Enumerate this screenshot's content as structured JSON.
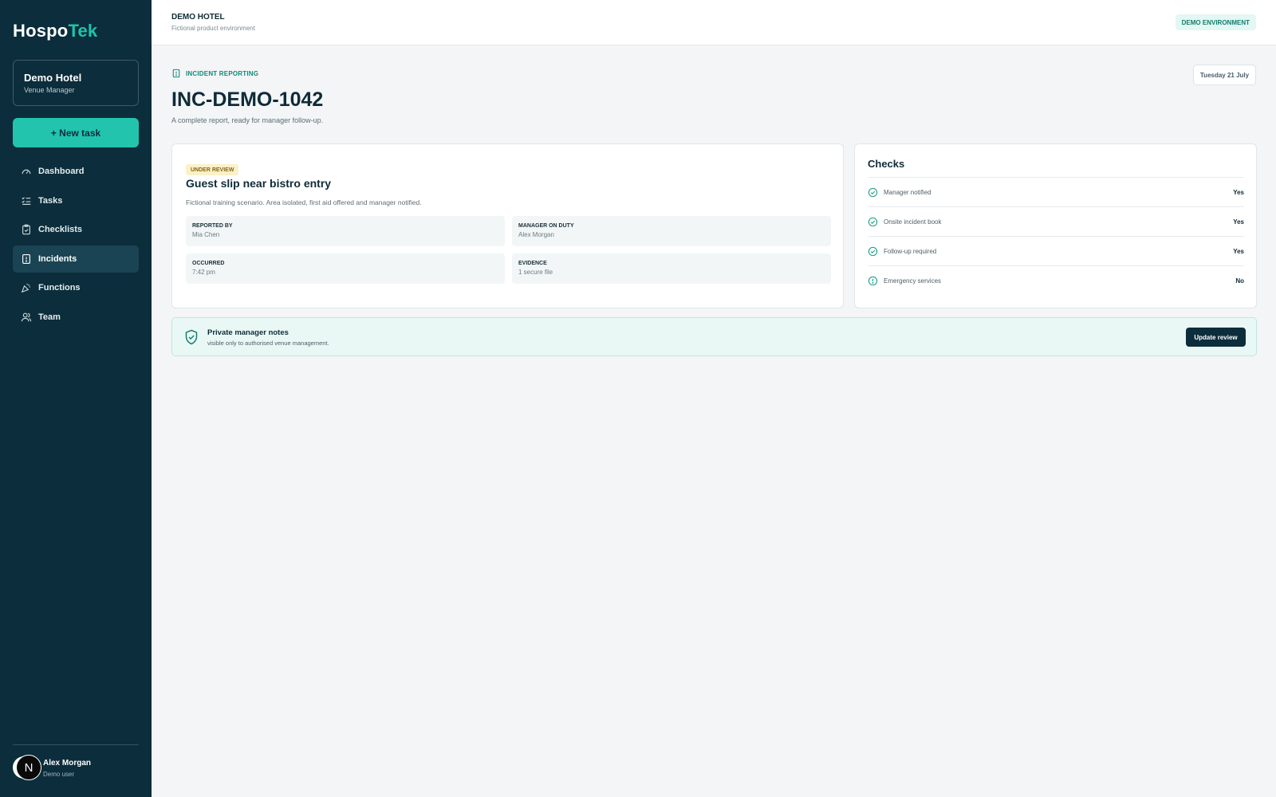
{
  "brand": {
    "part1": "Hospo",
    "part2": "Tek",
    "accent": "#20c3aa"
  },
  "venue": {
    "name": "Demo Hotel",
    "role": "Venue Manager"
  },
  "new_task_label": "+ New task",
  "nav": [
    {
      "label": "Dashboard",
      "icon": "gauge-icon",
      "active": false
    },
    {
      "label": "Tasks",
      "icon": "task-list-icon",
      "active": false
    },
    {
      "label": "Checklists",
      "icon": "clipboard-check-icon",
      "active": false
    },
    {
      "label": "Incidents",
      "icon": "incident-report-icon",
      "active": true
    },
    {
      "label": "Functions",
      "icon": "party-popper-icon",
      "active": false
    },
    {
      "label": "Team",
      "icon": "users-icon",
      "active": false
    }
  ],
  "user": {
    "avatar_letter": "N",
    "name": "Alex Morgan",
    "role": "Demo user"
  },
  "header": {
    "title": "DEMO HOTEL",
    "subtitle": "Fictional product environment",
    "env_badge": "DEMO ENVIRONMENT"
  },
  "page": {
    "section_label": "INCIDENT REPORTING",
    "date": "Tuesday 21 July",
    "title": "INC-DEMO-1042",
    "subtitle": "A complete report, ready for manager follow-up."
  },
  "incident": {
    "status": "UNDER REVIEW",
    "title": "Guest slip near bistro entry",
    "description": "Fictional training scenario. Area isolated, first aid offered and manager notified.",
    "fields": [
      {
        "label": "REPORTED BY",
        "value": "Mia Chen"
      },
      {
        "label": "MANAGER ON DUTY",
        "value": "Alex Morgan"
      },
      {
        "label": "OCCURRED",
        "value": "7:42 pm"
      },
      {
        "label": "EVIDENCE",
        "value": "1 secure file"
      }
    ]
  },
  "checks": {
    "title": "Checks",
    "items": [
      {
        "label": "Manager notified",
        "value": "Yes",
        "icon": "check-circle-icon"
      },
      {
        "label": "Onsite incident book",
        "value": "Yes",
        "icon": "check-circle-icon"
      },
      {
        "label": "Follow-up required",
        "value": "Yes",
        "icon": "check-circle-icon"
      },
      {
        "label": "Emergency services",
        "value": "No",
        "icon": "alert-circle-icon"
      }
    ]
  },
  "notes": {
    "title": "Private manager notes",
    "subtitle": "visible only to authorised venue management.",
    "button": "Update review"
  }
}
